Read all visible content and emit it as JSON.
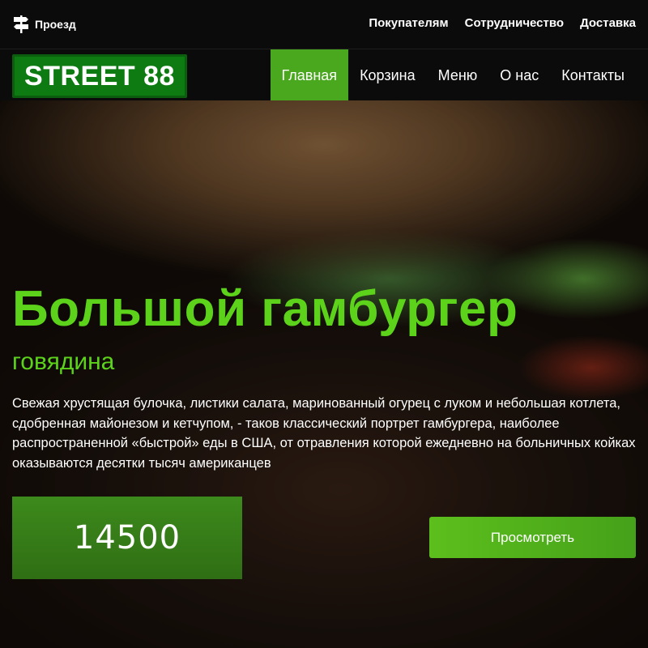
{
  "topbar": {
    "directions_label": "Проезд",
    "directions_icon": "signpost-icon",
    "links": [
      "Покупателям",
      "Сотрудничество",
      "Доставка"
    ]
  },
  "navbar": {
    "logo": "STREET 88",
    "items": [
      "Главная",
      "Корзина",
      "Меню",
      "О нас",
      "Контакты"
    ],
    "active_item": "Главная"
  },
  "hero": {
    "title": "Большой гамбургер",
    "subtitle": "говядина",
    "description": "Свежая хрустящая булочка, листики салата, маринованный огурец с луком и небольшая котлета, сдобренная майонезом и кетчупом, - таков классический портрет гамбургера, наиболее распространенной «быстрой» еды в США, от отравления которой ежедневно на больничных койках оказываются десятки тысяч американцев",
    "price": "14500",
    "button_label": "Просмотреть"
  },
  "colors": {
    "accent_green": "#5cd31a",
    "nav_active": "#4aa81e",
    "logo_bg": "#0d7a12",
    "bar_bg": "#0b0b0b"
  }
}
